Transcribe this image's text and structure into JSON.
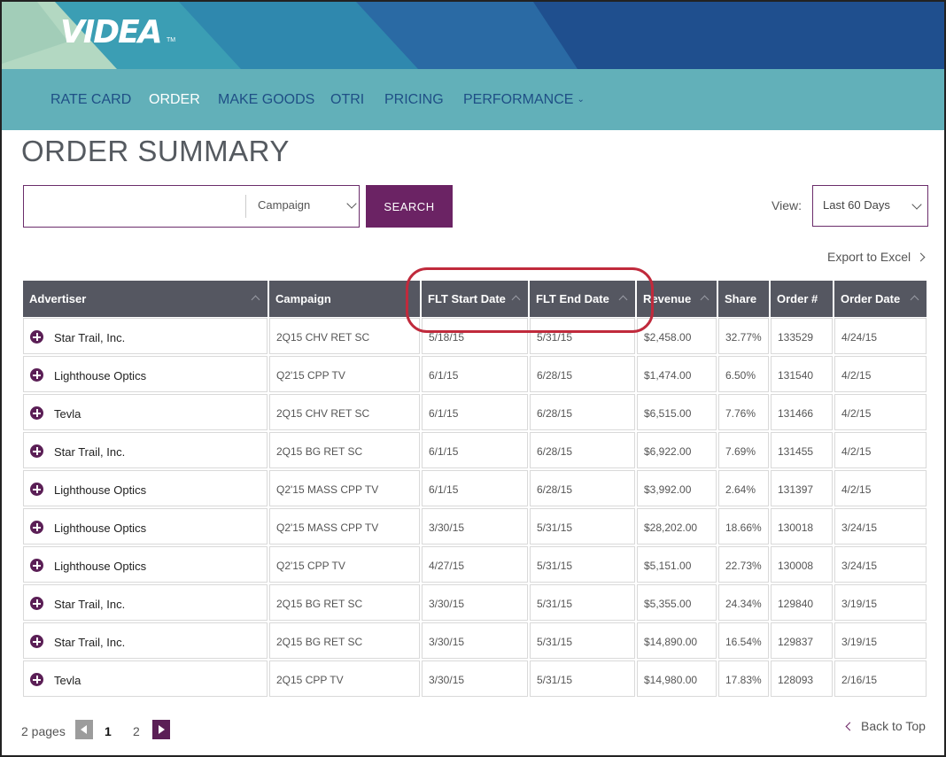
{
  "brand": {
    "logo": "VIDEA",
    "trademark": "TM"
  },
  "nav": {
    "items": [
      {
        "label": "RATE CARD",
        "active": false
      },
      {
        "label": "ORDER",
        "active": true
      },
      {
        "label": "MAKE GOODS",
        "active": false
      },
      {
        "label": "OTRI",
        "active": false
      },
      {
        "label": "PRICING",
        "active": false
      },
      {
        "label": "PERFORMANCE",
        "active": false,
        "has_dropdown": true
      }
    ]
  },
  "page": {
    "title": "ORDER SUMMARY"
  },
  "search": {
    "input_value": "",
    "field_select": "Campaign",
    "button_label": "SEARCH"
  },
  "view": {
    "label": "View:",
    "selected": "Last 60 Days"
  },
  "export_label": "Export to Excel",
  "table": {
    "columns": [
      "Advertiser",
      "Campaign",
      "FLT Start Date",
      "FLT End Date",
      "Revenue",
      "Share",
      "Order #",
      "Order Date"
    ],
    "rows": [
      [
        "Star Trail, Inc.",
        "2Q15 CHV RET SC",
        "5/18/15",
        "5/31/15",
        "$2,458.00",
        "32.77%",
        "133529",
        "4/24/15"
      ],
      [
        "Lighthouse Optics",
        "Q2'15  CPP TV",
        "6/1/15",
        "6/28/15",
        "$1,474.00",
        "6.50%",
        "131540",
        "4/2/15"
      ],
      [
        "Tevla",
        "2Q15 CHV RET SC",
        "6/1/15",
        "6/28/15",
        "$6,515.00",
        "7.76%",
        "131466",
        "4/2/15"
      ],
      [
        "Star Trail, Inc.",
        "2Q15 BG  RET SC",
        "6/1/15",
        "6/28/15",
        "$6,922.00",
        "7.69%",
        "131455",
        "4/2/15"
      ],
      [
        "Lighthouse Optics",
        "Q2'15 MASS CPP TV",
        "6/1/15",
        "6/28/15",
        "$3,992.00",
        "2.64%",
        "131397",
        "4/2/15"
      ],
      [
        "Lighthouse Optics",
        "Q2'15 MASS CPP TV",
        "3/30/15",
        "5/31/15",
        "$28,202.00",
        "18.66%",
        "130018",
        "3/24/15"
      ],
      [
        "Lighthouse Optics",
        "Q2'15 CPP TV",
        "4/27/15",
        "5/31/15",
        "$5,151.00",
        "22.73%",
        "130008",
        "3/24/15"
      ],
      [
        "Star Trail, Inc.",
        "2Q15 BG  RET SC",
        "3/30/15",
        "5/31/15",
        "$5,355.00",
        "24.34%",
        "129840",
        "3/19/15"
      ],
      [
        "Star Trail, Inc.",
        "2Q15 BG  RET SC",
        "3/30/15",
        "5/31/15",
        "$14,890.00",
        "16.54%",
        "129837",
        "3/19/15"
      ],
      [
        "Tevla",
        "2Q15  CPP TV",
        "3/30/15",
        "5/31/15",
        "$14,980.00",
        "17.83%",
        "128093",
        "2/16/15"
      ]
    ]
  },
  "pagination": {
    "label": "2 pages",
    "pages": [
      "1",
      "2"
    ],
    "current": "1"
  },
  "back_to_top": "Back to Top",
  "colors": {
    "nav_bg": "#62b0b9",
    "nav_text": "#1f4f86",
    "accent_purple": "#6b2364",
    "table_header": "#555761",
    "highlight": "#c02a3c"
  }
}
